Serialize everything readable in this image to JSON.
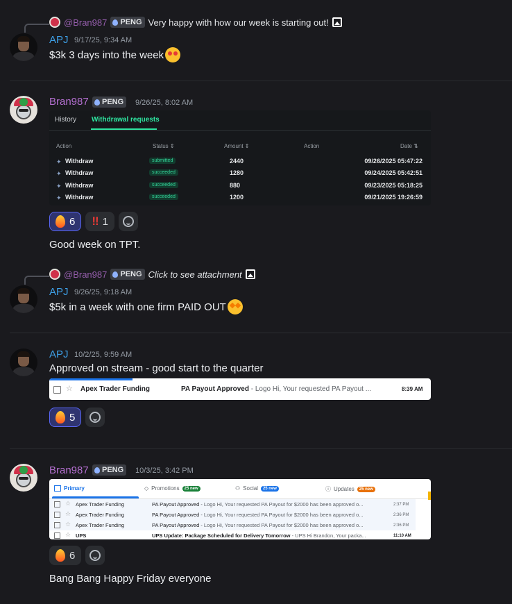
{
  "messages": {
    "m1": {
      "reply": {
        "user": "@Bran987",
        "tag": "PENG",
        "text": "Very happy with how our week is starting out!"
      },
      "author": "APJ",
      "time": "9/17/25, 9:34 AM",
      "text": "$3k 3 days into the week"
    },
    "m2": {
      "author": "Bran987",
      "tag": "PENG",
      "time": "9/26/25, 8:02 AM",
      "embed": {
        "tabs": [
          "History",
          "Withdrawal requests"
        ],
        "headers": [
          "Action",
          "Status",
          "Amount",
          "Action",
          "Date"
        ],
        "rows": [
          {
            "action": "Withdraw",
            "status": "submitted",
            "amount": "2440",
            "date": "09/26/2025 05:47:22"
          },
          {
            "action": "Withdraw",
            "status": "succeeded",
            "amount": "1280",
            "date": "09/24/2025 05:42:51"
          },
          {
            "action": "Withdraw",
            "status": "succeeded",
            "amount": "880",
            "date": "09/23/2025 05:18:25"
          },
          {
            "action": "Withdraw",
            "status": "succeeded",
            "amount": "1200",
            "date": "09/21/2025 19:26:59"
          }
        ]
      },
      "reactions": [
        {
          "emoji": "fire",
          "count": "6"
        },
        {
          "emoji": "double-exclamation",
          "count": "1"
        }
      ],
      "followup": "Good week on TPT."
    },
    "m3": {
      "reply": {
        "user": "@Bran987",
        "tag": "PENG",
        "text": "Click to see attachment"
      },
      "author": "APJ",
      "time": "9/26/25, 9:18 AM",
      "text": "$5k in a week with one firm PAID OUT"
    },
    "m4": {
      "author": "APJ",
      "time": "10/2/25, 9:59 AM",
      "text": "Approved on stream - good start to the quarter",
      "embed": {
        "from": "Apex Trader Funding",
        "subject": "PA Payout Approved",
        "snippet": " - Logo Hi, Your requested PA Payout ...",
        "time": "8:39 AM"
      },
      "reactions": [
        {
          "emoji": "fire",
          "count": "5"
        }
      ]
    },
    "m5": {
      "author": "Bran987",
      "tag": "PENG",
      "time": "10/3/25, 3:42 PM",
      "embed": {
        "tabs": [
          {
            "label": "Primary"
          },
          {
            "label": "Promotions",
            "badge": "25 new"
          },
          {
            "label": "Social",
            "badge": "25 new"
          },
          {
            "label": "Updates",
            "badge": "25 new"
          }
        ],
        "rows": [
          {
            "from": "Apex Trader Funding",
            "subject": "PA Payout Approved",
            "snippet": " - Logo Hi, Your requested PA Payout for $2000 has been approved o...",
            "time": "2:37 PM"
          },
          {
            "from": "Apex Trader Funding",
            "subject": "PA Payout Approved",
            "snippet": " - Logo Hi, Your requested PA Payout for $2000 has been approved o...",
            "time": "2:36 PM"
          },
          {
            "from": "Apex Trader Funding",
            "subject": "PA Payout Approved",
            "snippet": " - Logo Hi, Your requested PA Payout for $2000 has been approved o...",
            "time": "2:36 PM"
          },
          {
            "from": "UPS",
            "subject": "UPS Update: Package Scheduled for Delivery Tomorrow",
            "snippet": " - UPS Hi Brandon, Your packa...",
            "time": "11:10 AM"
          }
        ]
      },
      "reactions": [
        {
          "emoji": "fire",
          "count": "6"
        }
      ],
      "followup": "Bang Bang Happy Friday everyone"
    }
  },
  "colors": {
    "apj": "#3ea0e8",
    "bran": "#b46fd0",
    "bg": "#1a1a1e",
    "accent_green": "#2ee6a1"
  }
}
